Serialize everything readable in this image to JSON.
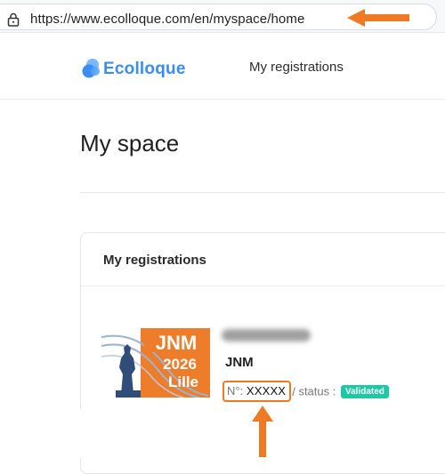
{
  "browser": {
    "url": "https://www.ecolloque.com/en/myspace/home",
    "accent": "#f07a24"
  },
  "header": {
    "logo_text": "Ecolloque",
    "nav_registrations": "My registrations",
    "brand_color": "#3a8df4"
  },
  "page": {
    "title": "My space"
  },
  "registrations_card": {
    "title": "My registrations",
    "item": {
      "event_logo_title": "JNM",
      "event_logo_year": "2026",
      "event_logo_city": "Lille",
      "event_name": "JNM",
      "number_prefix": "N°:",
      "number_value": "XXXXX",
      "separator": "/",
      "status_label": "status :",
      "status_value": "Validated",
      "status_color": "#1cc9a5"
    }
  }
}
